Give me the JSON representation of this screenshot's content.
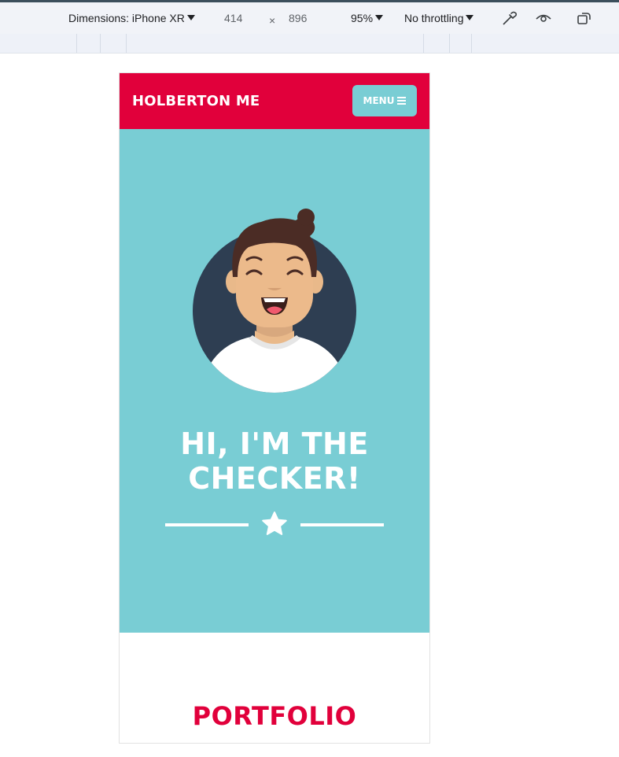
{
  "devtools": {
    "dimensions_label": "Dimensions: iPhone XR",
    "width": "414",
    "times": "×",
    "height": "896",
    "zoom": "95%",
    "throttling": "No throttling",
    "icons": [
      "eyedropper-icon",
      "eye-icon",
      "rotate-icon"
    ]
  },
  "page": {
    "brand": "HOLBERTON ME",
    "menu_label": "MENU",
    "hero_title_line1": "HI, I'M THE",
    "hero_title_line2": "CHECKER!",
    "section_title": "PORTFOLIO"
  },
  "colors": {
    "brand_red": "#e1003b",
    "hero_teal": "#79cdd4",
    "avatar_bg": "#2e3e52"
  }
}
